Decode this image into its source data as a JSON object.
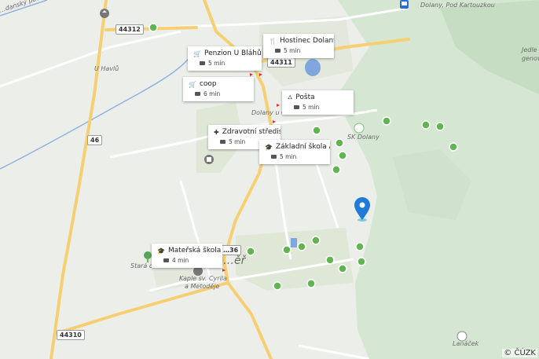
{
  "colors": {
    "background": "#eceeea",
    "forest": "#d5e6d3",
    "forest_dark": "#c7ddc3",
    "built_up": "#dfe8d7",
    "main_road": "#f6cf73",
    "minor_road": "#ffffff",
    "water": "#7fa7de",
    "pin": "#1f7bd8",
    "poi_green": "#62b453"
  },
  "map": {
    "places": [
      "Dolany, Pod Kartouzkou",
      "U Havlů",
      "Dolany u Ol…",
      "SK Dolany",
      "Stará cil…",
      "Kaple sv. Cyrila",
      "a Metoděje",
      "Lanáček",
      "Jedle",
      "genov…",
      "…danský potok",
      "…ěř"
    ],
    "road_badges": [
      "44312",
      "44311",
      "46",
      "44310",
      "…36"
    ]
  },
  "pois": [
    {
      "icon": "restaurant-icon",
      "glyph": "🍴",
      "name": "Hostinec Dolany",
      "time": "5 min"
    },
    {
      "icon": "shop-cart-icon",
      "glyph": "🛒",
      "name": "Penzion U Bláhů",
      "time": "5 min"
    },
    {
      "icon": "shop-cart-icon",
      "glyph": "🛒",
      "name": "coop",
      "time": "6 min"
    },
    {
      "icon": "post-office-icon",
      "glyph": "⛼",
      "name": "Pošta",
      "time": "5 min"
    },
    {
      "icon": "medical-icon",
      "glyph": "✚",
      "name": "Zdravotní středisko",
      "time": "5 min"
    },
    {
      "icon": "school-icon",
      "glyph": "🎓",
      "name": "Základní škola Al…",
      "time": "5 min"
    },
    {
      "icon": "school-icon",
      "glyph": "🎓",
      "name": "Mateřská škola T…",
      "time": "4 min"
    }
  ],
  "copyright": "© ČÚZK"
}
